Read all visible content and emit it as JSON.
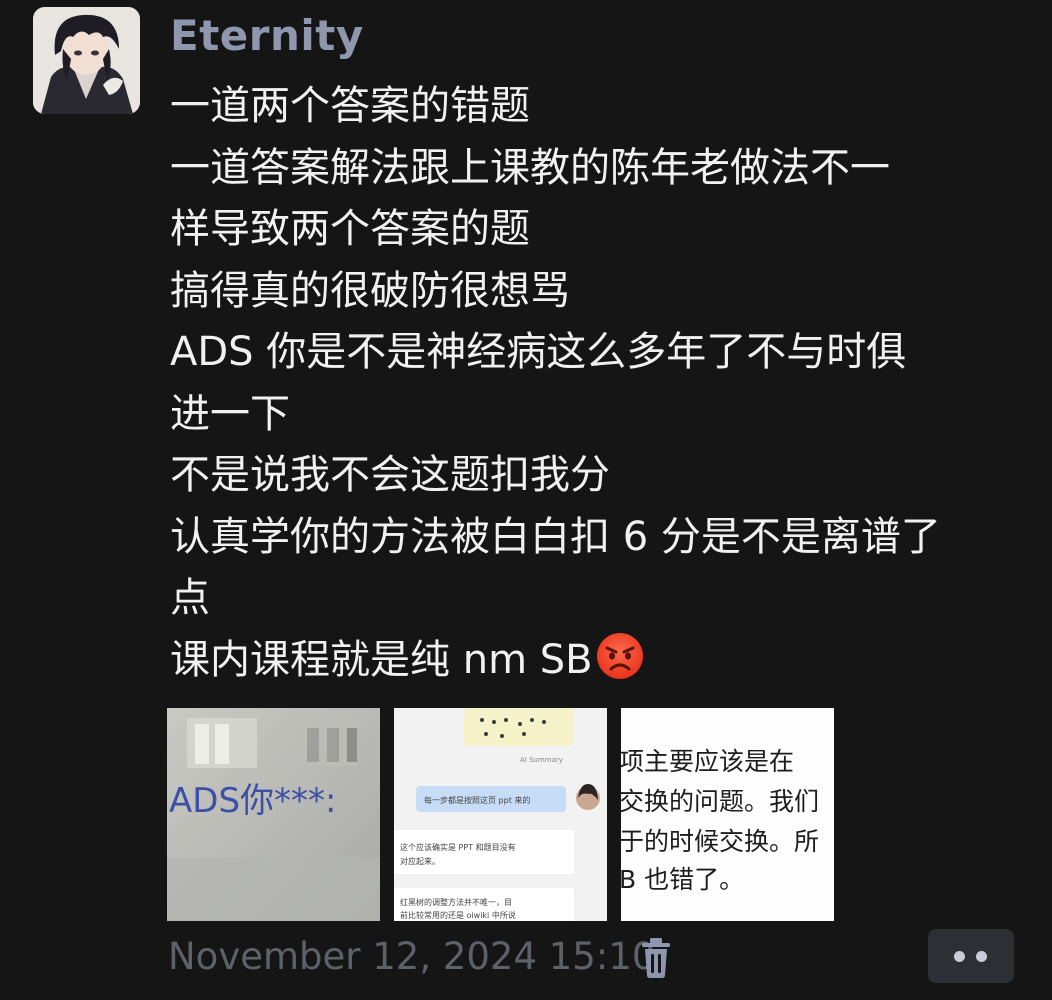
{
  "sender": {
    "name": "Eternity",
    "avatar_icon": "anime-avatar-icon"
  },
  "message": {
    "lines": [
      "一道两个答案的错题",
      "一道答案解法跟上课教的陈年老做法不一",
      "样导致两个答案的题",
      "搞得真的很破防很想骂",
      "ADS 你是不是神经病这么多年了不与时俱",
      "进一下",
      "不是说我不会这题扣我分",
      "认真学你的方法被白白扣 6 分是不是离谱了",
      "点",
      "课内课程就是纯 nm SB"
    ],
    "emoji": "angry-face-emoji"
  },
  "attachments": [
    {
      "type": "photo",
      "text": "ADS你***:"
    },
    {
      "type": "chat-screenshot",
      "header": "AI Summary",
      "bubble": "每一步都是按照这页 ppt 来的",
      "reply1_line1": "这个应该确实是 PPT 和题目没有",
      "reply1_line2": "对应起来。",
      "reply2_line1": "红黑树的调整方法并不唯一，目",
      "reply2_line2": "前比较常用的还是 oiwiki 中所说"
    },
    {
      "type": "text-screenshot",
      "line1": "项主要应该是在",
      "line2": "交换的问题。我们",
      "line3": "于的时候交换。所",
      "line4": "B 也错了。"
    }
  ],
  "footer": {
    "timestamp": "November 12, 2024 15:10",
    "delete_icon": "trash-icon",
    "more_icon": "more-icon"
  },
  "colors": {
    "background": "#151515",
    "username": "#8e97ad",
    "message_text": "#f1f1f1",
    "timestamp": "#5d626a",
    "button_bg": "#2c2f34"
  }
}
